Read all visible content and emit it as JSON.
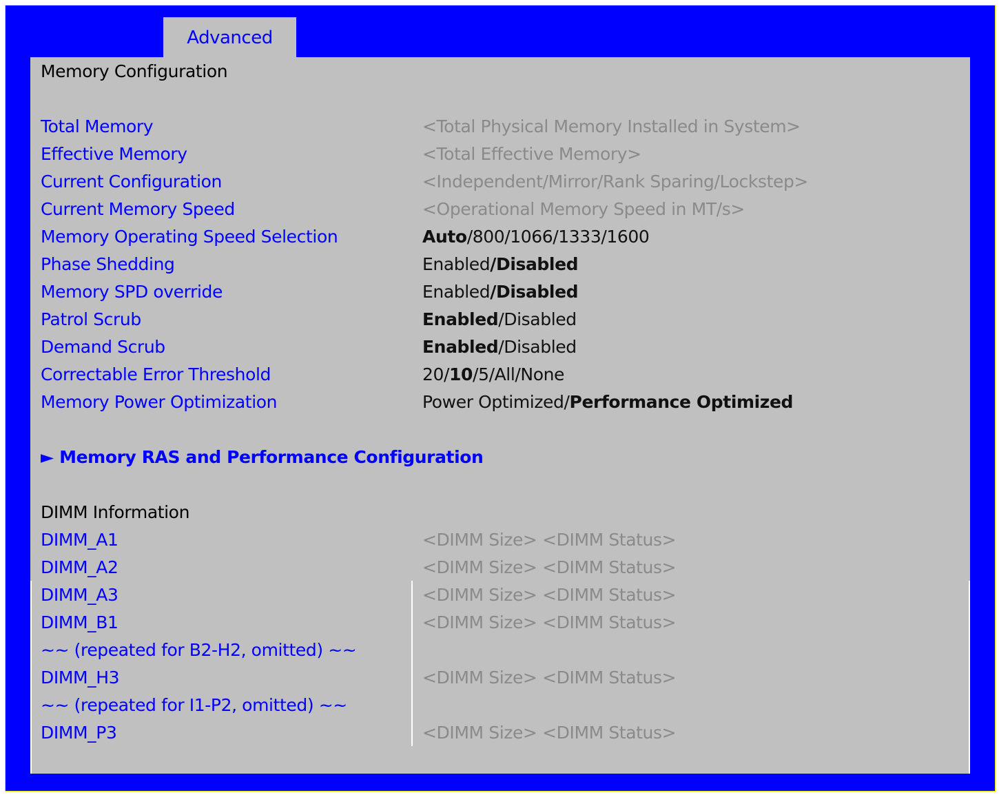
{
  "tab": {
    "label": "Advanced"
  },
  "section_title": "Memory Configuration",
  "settings": [
    {
      "label": "Total Memory",
      "value": "<Total Physical Memory Installed in System>"
    },
    {
      "label": "Effective Memory",
      "value": "<Total Effective Memory>"
    },
    {
      "label": "Current Configuration",
      "value": "<Independent/Mirror/Rank Sparing/Lockstep>"
    },
    {
      "label": "Current Memory Speed",
      "value": "<Operational Memory Speed in MT/s>"
    },
    {
      "label": "Memory Operating Speed Selection",
      "value_default": "Auto",
      "value_rest": "/800/1066/1333/1600"
    },
    {
      "label": "Phase Shedding",
      "value_first": "Enabled",
      "value_default": "/Disabled"
    },
    {
      "label": "Memory SPD override",
      "value_first": "Enabled",
      "value_default": "/Disabled"
    },
    {
      "label": "Patrol Scrub",
      "value_default": "Enabled",
      "value_rest": "/Disabled"
    },
    {
      "label": "Demand Scrub",
      "value_default": "Enabled",
      "value_rest": "/Disabled"
    },
    {
      "label": "Correctable Error Threshold",
      "value_first": "20/",
      "value_default": "10",
      "value_rest": "/5/All/None"
    },
    {
      "label": "Memory Power Optimization",
      "value_first": "Power Optimized/",
      "value_default": "Performance Optimized"
    }
  ],
  "submenu": {
    "label": "► Memory RAS and Performance Configuration"
  },
  "dimm_heading": "DIMM Information",
  "dimms": [
    {
      "label": "DIMM_A1",
      "value": "<DIMM Size> <DIMM Status>"
    },
    {
      "label": "DIMM_A2",
      "value": "<DIMM Size> <DIMM Status>"
    },
    {
      "label": "DIMM_A3",
      "value": "<DIMM Size> <DIMM Status>"
    },
    {
      "label": "DIMM_B1",
      "value": "<DIMM Size> <DIMM Status>"
    },
    {
      "label": "~~ (repeated for B2-H2, omitted) ~~",
      "value": ""
    },
    {
      "label": "DIMM_H3",
      "value": "<DIMM Size> <DIMM Status>"
    },
    {
      "label": "~~ (repeated for I1-P2, omitted) ~~",
      "value": ""
    },
    {
      "label": "DIMM_P3",
      "value": "<DIMM Size> <DIMM Status>"
    }
  ]
}
